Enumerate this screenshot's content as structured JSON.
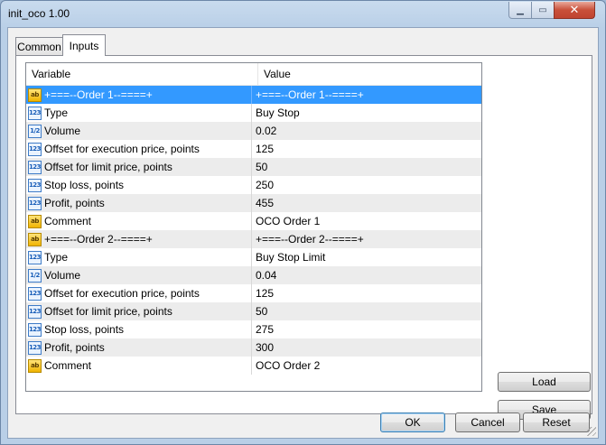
{
  "window": {
    "title": "init_oco 1.00",
    "close_glyph": "✕",
    "min_glyph": "▁",
    "max_glyph": "▭"
  },
  "tabs": [
    {
      "label": "Common",
      "active": false
    },
    {
      "label": "Inputs",
      "active": true
    }
  ],
  "grid": {
    "columns": [
      "Variable",
      "Value"
    ],
    "rows": [
      {
        "icon": "ab",
        "type": "string",
        "variable": "+===--Order 1--====+",
        "value": "+===--Order 1--====+"
      },
      {
        "icon": "123",
        "type": "int",
        "variable": "Type",
        "value": "Buy Stop"
      },
      {
        "icon": "1/2",
        "type": "double",
        "variable": "Volume",
        "value": "0.02"
      },
      {
        "icon": "123",
        "type": "int",
        "variable": "Offset for execution price, points",
        "value": "125"
      },
      {
        "icon": "123",
        "type": "int",
        "variable": "Offset for limit price, points",
        "value": "50"
      },
      {
        "icon": "123",
        "type": "int",
        "variable": "Stop loss, points",
        "value": "250"
      },
      {
        "icon": "123",
        "type": "int",
        "variable": "Profit, points",
        "value": "455"
      },
      {
        "icon": "ab",
        "type": "string",
        "variable": "Comment",
        "value": "OCO Order 1"
      },
      {
        "icon": "ab",
        "type": "string",
        "variable": "+===--Order 2--====+",
        "value": "+===--Order 2--====+"
      },
      {
        "icon": "123",
        "type": "int",
        "variable": "Type",
        "value": "Buy Stop Limit"
      },
      {
        "icon": "1/2",
        "type": "double",
        "variable": "Volume",
        "value": "0.04"
      },
      {
        "icon": "123",
        "type": "int",
        "variable": "Offset for execution price, points",
        "value": "125"
      },
      {
        "icon": "123",
        "type": "int",
        "variable": "Offset for limit price, points",
        "value": "50"
      },
      {
        "icon": "123",
        "type": "int",
        "variable": "Stop loss, points",
        "value": "275"
      },
      {
        "icon": "123",
        "type": "int",
        "variable": "Profit, points",
        "value": "300"
      },
      {
        "icon": "ab",
        "type": "string",
        "variable": "Comment",
        "value": "OCO Order 2"
      }
    ]
  },
  "buttons": {
    "load": "Load",
    "save": "Save",
    "ok": "OK",
    "cancel": "Cancel",
    "reset": "Reset"
  },
  "colors": {
    "selection": "#3399ff",
    "alt_row": "#ececec"
  }
}
